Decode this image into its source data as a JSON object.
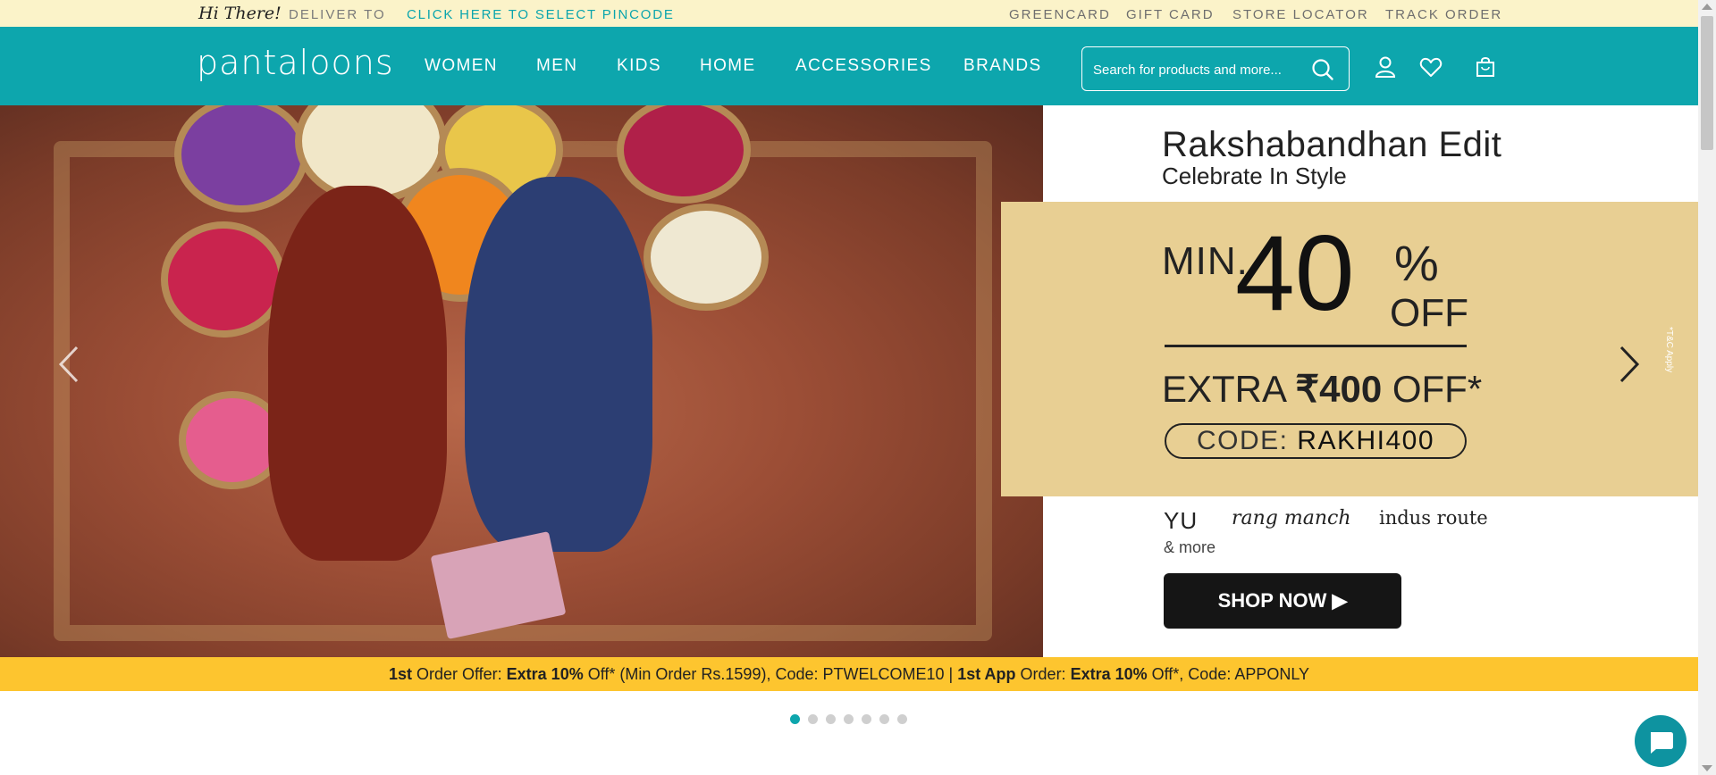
{
  "topbar": {
    "greeting": "Hi There!",
    "deliver_to": "DELIVER TO",
    "pincode_link": "CLICK HERE TO SELECT PINCODE",
    "links": [
      "GREENCARD",
      "GIFT CARD",
      "STORE LOCATOR",
      "TRACK ORDER"
    ]
  },
  "header": {
    "logo": "pantaloons",
    "nav": [
      "WOMEN",
      "MEN",
      "KIDS",
      "HOME",
      "ACCESSORIES",
      "BRANDS"
    ],
    "search_placeholder": "Search for products and more...",
    "icons": [
      "search-icon",
      "account-icon",
      "wishlist-icon",
      "bag-icon"
    ]
  },
  "hero": {
    "heading": "Rakshabandhan Edit",
    "subheading": "Celebrate In Style",
    "min": "MIN.",
    "discount": "40",
    "percent": "%",
    "off": "OFF",
    "extra_pre": "EXTRA ",
    "extra_amount": "₹400",
    "extra_post": " OFF*",
    "code_label": "CODE: ",
    "code": "RAKHI400",
    "tnc": "*T&C Apply",
    "brands": [
      "YU",
      "rang manch",
      "indus route"
    ],
    "and_more": "& more",
    "cta": "SHOP NOW ▶"
  },
  "offer_strip": {
    "p1": "1st",
    "p2": " Order Offer: ",
    "p3": "Extra 10%",
    "p4": " Off* (Min Order Rs.1599), Code: PTWELCOME10 | ",
    "p5": "1st App",
    "p6": " Order: ",
    "p7": "Extra 10%",
    "p8": " Off*, Code: APPONLY"
  },
  "carousel": {
    "slide_count": 7,
    "active_index": 0
  },
  "colors": {
    "topbar_bg": "#fbf3c9",
    "brand_teal": "#0da6ad",
    "promo_gold": "#e8cf93",
    "offer_yellow": "#fdc52f"
  }
}
